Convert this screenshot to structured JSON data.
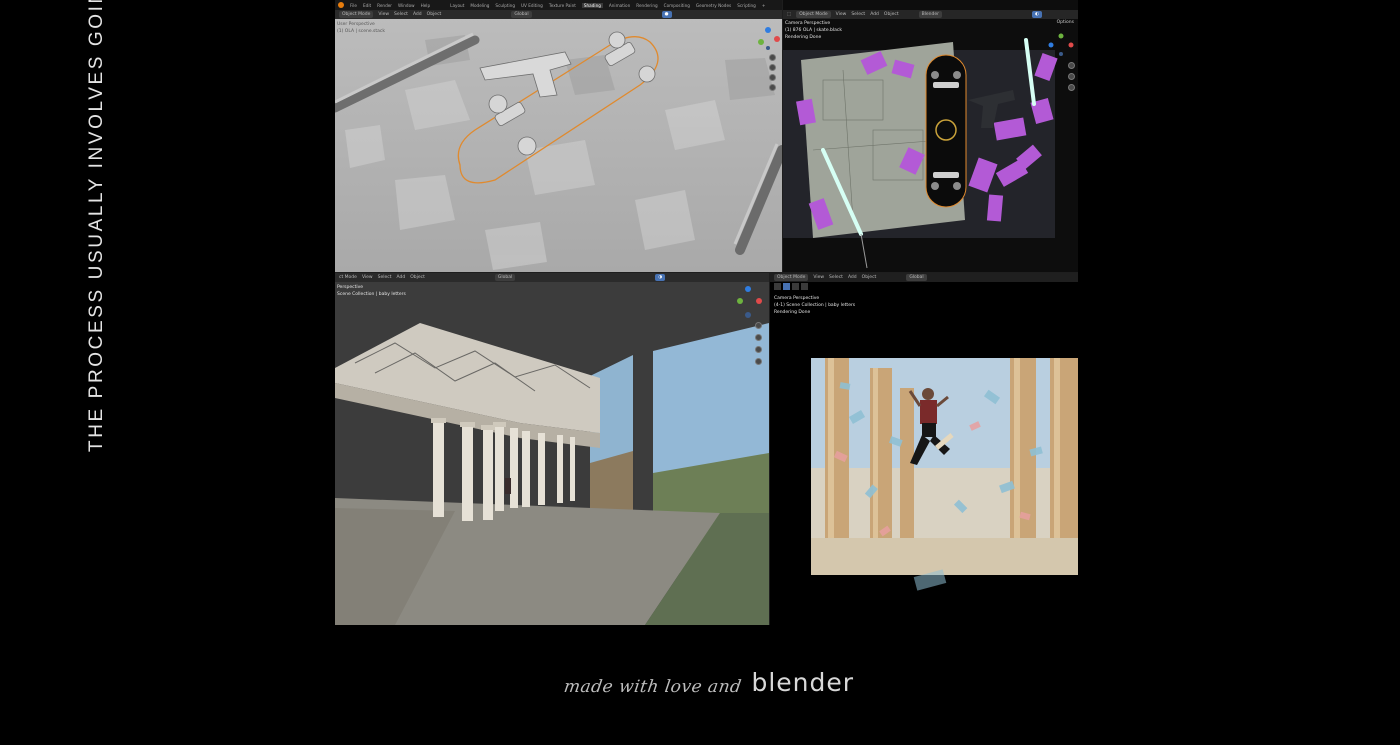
{
  "side_title": "THE PROCESS USUALLY INVOLVES GOING BACK AND",
  "footer": {
    "script": "made with love and",
    "word": "blender"
  },
  "topbar": {
    "menus": [
      "File",
      "Edit",
      "Render",
      "Window",
      "Help"
    ],
    "workspaces": [
      "Layout",
      "Modeling",
      "Sculpting",
      "UV Editing",
      "Texture Paint",
      "Shading",
      "Animation",
      "Rendering",
      "Compositing",
      "Geometry Nodes",
      "Scripting"
    ],
    "active_workspace": "Shading"
  },
  "panel_tl": {
    "mode": "Object Mode",
    "menu": [
      "View",
      "Select",
      "Add",
      "Object"
    ],
    "transform": "Global",
    "overlay": [
      "User Perspective",
      "(1) OLA | scene.stack"
    ]
  },
  "panel_tr": {
    "mode": "Object Mode",
    "menu": [
      "View",
      "Select",
      "Add",
      "Object"
    ],
    "render_engine": "Blender",
    "options_label": "Options",
    "overlay": [
      "Camera Perspective",
      "(1) 876 OLA | skate.black",
      "Rendering Done"
    ]
  },
  "panel_bl": {
    "mode": "ct Mode",
    "menu": [
      "View",
      "Select",
      "Add",
      "Object"
    ],
    "transform": "Global",
    "overlay": [
      "Perspective",
      "Scene Collection | baby letters"
    ]
  },
  "panel_br": {
    "mode": "Object Mode",
    "menu": [
      "View",
      "Select",
      "Add",
      "Object"
    ],
    "transform": "Global",
    "overlay": [
      "Camera Perspective",
      "(4-1) Scene Collection | baby letters",
      "Rendering Done"
    ]
  },
  "colors": {
    "background": "#000000",
    "blender_active": "#4772b3",
    "skateboard_outline": "#e08a2e",
    "card_purple": "#b35ad6"
  }
}
